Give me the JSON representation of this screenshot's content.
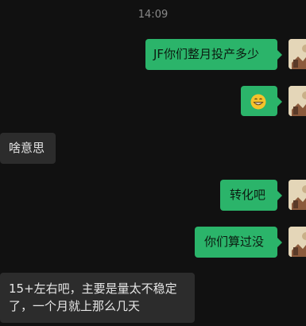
{
  "timestamp": "14:09",
  "messages": [
    {
      "side": "out",
      "type": "text",
      "text": "JF你们整月投产多少"
    },
    {
      "side": "out",
      "type": "emoji",
      "icon": "grinning-emoji-icon",
      "text": "😁"
    },
    {
      "side": "in",
      "type": "text",
      "text": "啥意思"
    },
    {
      "side": "out",
      "type": "text",
      "text": "转化吧"
    },
    {
      "side": "out",
      "type": "text",
      "text": "你们算过没"
    },
    {
      "side": "in",
      "type": "text",
      "text": "15+左右吧，主要是量太不稳定了，一个月就上那么几天"
    }
  ],
  "colors": {
    "background": "#111111",
    "outgoing_bubble": "#2bb46a",
    "incoming_bubble": "#2c2c2c"
  }
}
